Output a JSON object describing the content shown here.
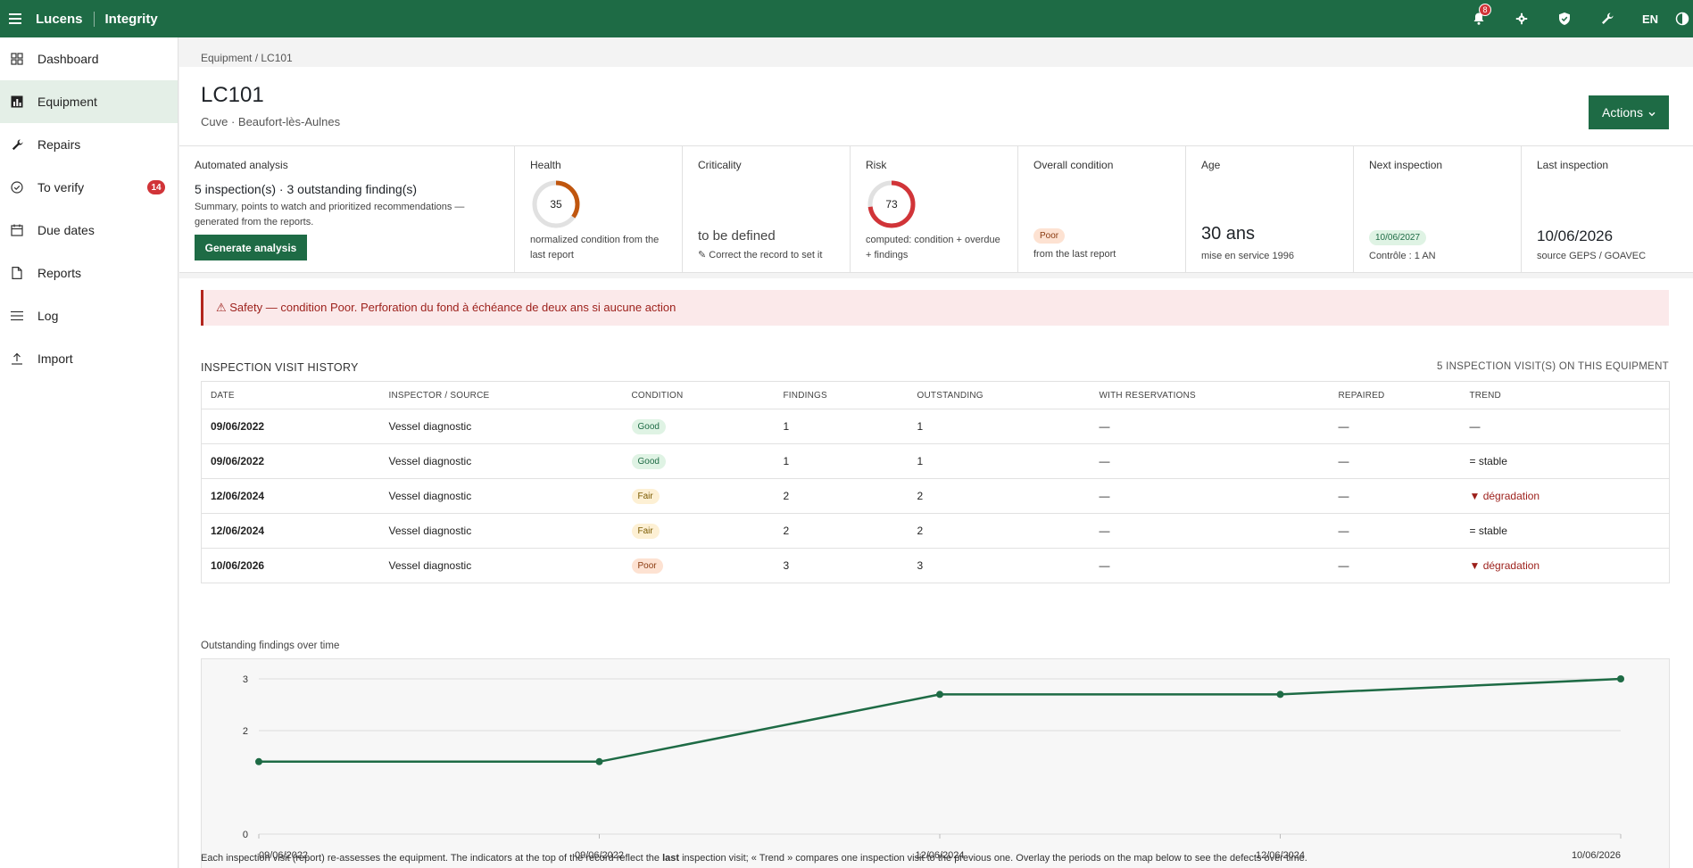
{
  "topbar": {
    "brand": "Lucens",
    "product": "Integrity",
    "notifications_count": "8",
    "lang": "EN",
    "icons": [
      "menu-icon",
      "bell-icon",
      "gear-icon",
      "shield-icon",
      "wrench-icon",
      "contrast-icon"
    ]
  },
  "sidebar": {
    "items": [
      {
        "label": "Dashboard",
        "icon": "grid-icon"
      },
      {
        "label": "Equipment",
        "icon": "chart-icon",
        "active": true
      },
      {
        "label": "Repairs",
        "icon": "wrench-icon"
      },
      {
        "label": "To verify",
        "icon": "check-circle-icon",
        "badge": "14"
      },
      {
        "label": "Due dates",
        "icon": "calendar-icon"
      },
      {
        "label": "Reports",
        "icon": "document-icon"
      },
      {
        "label": "Log",
        "icon": "list-icon"
      },
      {
        "label": "Import",
        "icon": "upload-icon"
      }
    ]
  },
  "breadcrumb": "Equipment / LC101",
  "header": {
    "title": "LC101",
    "subtitle": "Cuve · Beaufort-lès-Aulnes",
    "actions_label": "Actions"
  },
  "kpis": {
    "analysis": {
      "label": "Automated analysis",
      "headline": "5 inspection(s) · 3 outstanding finding(s)",
      "text": "Summary, points to watch and prioritized recommendations — generated from the reports.",
      "button": "Generate analysis"
    },
    "health": {
      "label": "Health",
      "value": "35",
      "fraction": 0.35,
      "note": "normalized condition from the last report",
      "color": "#c0560e"
    },
    "criticality": {
      "label": "Criticality",
      "value": "to be defined",
      "note": "✎ Correct the record to set it"
    },
    "risk": {
      "label": "Risk",
      "value": "73",
      "fraction": 0.73,
      "note": "computed: condition + overdue + findings",
      "color": "#d13438"
    },
    "overall": {
      "label": "Overall condition",
      "value": "Poor",
      "note": "from the last report"
    },
    "age": {
      "label": "Age",
      "value": "30 ans",
      "note": "mise en service 1996"
    },
    "next": {
      "label": "Next inspection",
      "value": "10/06/2027",
      "note": "Contrôle : 1 AN"
    },
    "last": {
      "label": "Last inspection",
      "value": "10/06/2026",
      "note": "source GEPS / GOAVEC"
    }
  },
  "alert": "⚠ Safety — condition Poor. Perforation du fond à échéance de deux ans si aucune action",
  "history": {
    "title": "INSPECTION VISIT HISTORY",
    "count": "5 INSPECTION VISIT(S) ON THIS EQUIPMENT",
    "columns": [
      "DATE",
      "INSPECTOR / SOURCE",
      "CONDITION",
      "FINDINGS",
      "OUTSTANDING",
      "WITH RESERVATIONS",
      "REPAIRED",
      "TREND"
    ],
    "rows": [
      {
        "date": "09/06/2022",
        "source": "Vessel diagnostic",
        "condition": "Good",
        "cond_class": "good",
        "findings": "1",
        "outstanding": "1",
        "reservations": "—",
        "repaired": "—",
        "trend": "—",
        "trend_class": ""
      },
      {
        "date": "09/06/2022",
        "source": "Vessel diagnostic",
        "condition": "Good",
        "cond_class": "good",
        "findings": "1",
        "outstanding": "1",
        "reservations": "—",
        "repaired": "—",
        "trend": "= stable",
        "trend_class": ""
      },
      {
        "date": "12/06/2024",
        "source": "Vessel diagnostic",
        "condition": "Fair",
        "cond_class": "fair",
        "findings": "2",
        "outstanding": "2",
        "reservations": "—",
        "repaired": "—",
        "trend": "▼ dégradation",
        "trend_class": "trend-deg"
      },
      {
        "date": "12/06/2024",
        "source": "Vessel diagnostic",
        "condition": "Fair",
        "cond_class": "fair",
        "findings": "2",
        "outstanding": "2",
        "reservations": "—",
        "repaired": "—",
        "trend": "= stable",
        "trend_class": ""
      },
      {
        "date": "10/06/2026",
        "source": "Vessel diagnostic",
        "condition": "Poor",
        "cond_class": "poor",
        "findings": "3",
        "outstanding": "3",
        "reservations": "—",
        "repaired": "—",
        "trend": "▼ dégradation",
        "trend_class": "trend-deg"
      }
    ]
  },
  "chart_title": "Outstanding findings over time",
  "chart_data": {
    "type": "line",
    "x": [
      "09/06/2022",
      "09/06/2022",
      "12/06/2024",
      "12/06/2024",
      "10/06/2026"
    ],
    "values": [
      1.4,
      1.4,
      2.7,
      2.7,
      3.0
    ],
    "yticks": [
      0,
      2,
      3
    ],
    "ylim": [
      0,
      3
    ],
    "color": "#1e6b45",
    "grid": true
  },
  "footnote": {
    "before": "Each inspection visit (report) re-assesses the equipment. The indicators at the top of the record reflect the ",
    "bold": "last",
    "after": " inspection visit; « Trend » compares one inspection visit to the previous one. Overlay the periods on the map below to see the defects over time."
  }
}
